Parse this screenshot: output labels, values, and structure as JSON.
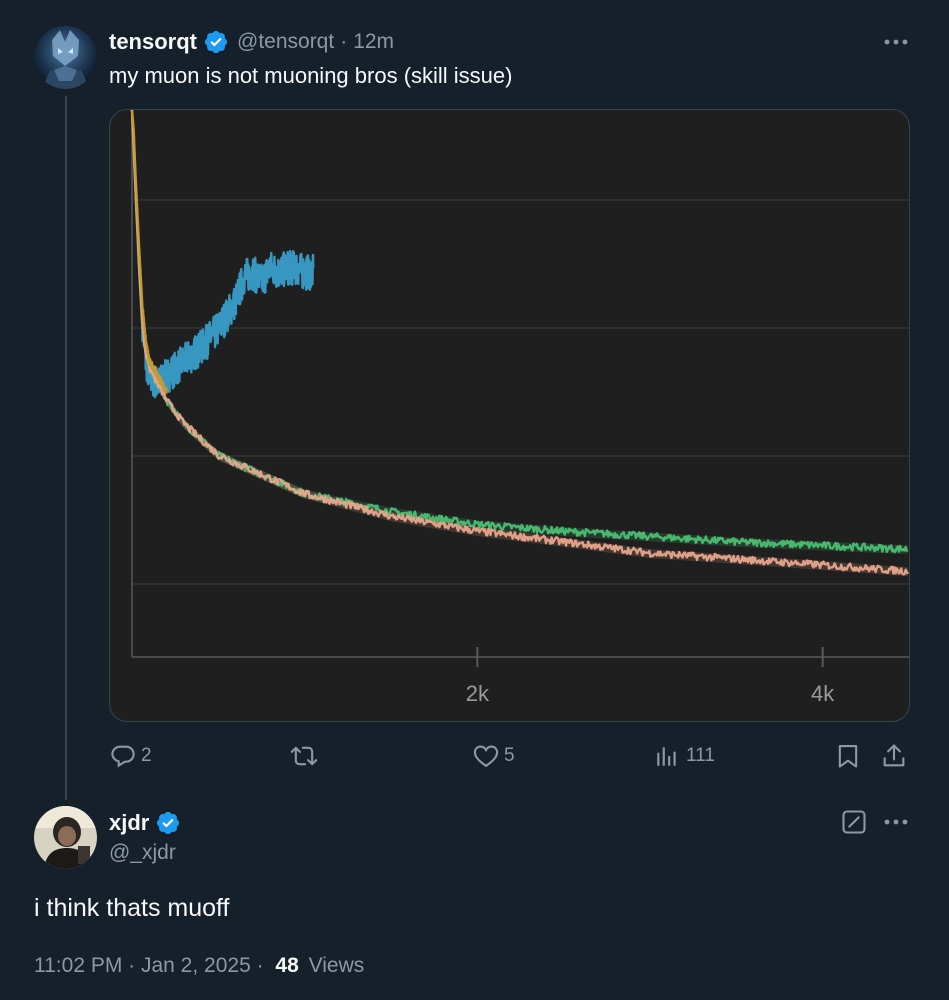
{
  "tweet": {
    "author_name": "tensorqt",
    "handle": "@tensorqt",
    "separator": "·",
    "time_ago": "12m",
    "text": "my muon is not muoning bros (skill issue)",
    "more_icon": "more-dots-icon",
    "actions": {
      "replies": "2",
      "retweets": "",
      "likes": "5",
      "views": "111"
    },
    "chart_data": {
      "type": "line",
      "x_tick_labels": [
        "2k",
        "4k"
      ],
      "xlim": [
        0,
        4500
      ],
      "grid": true,
      "series": [
        {
          "color": "#3a9ec9",
          "x": [
            0,
            20,
            40,
            60,
            80,
            100,
            150,
            200,
            300,
            400,
            500,
            600,
            650,
            700,
            750,
            800,
            850,
            900,
            950,
            1000,
            1050
          ],
          "y": [
            100,
            68,
            46,
            33,
            27,
            25,
            24,
            25,
            27,
            29,
            32,
            37,
            42,
            43,
            41,
            44,
            43,
            44,
            44,
            43,
            43
          ]
        },
        {
          "color": "#4bbf73",
          "x": [
            0,
            20,
            40,
            60,
            80,
            100,
            200,
            300,
            500,
            1000,
            1500,
            2000,
            2500,
            3000,
            3500,
            4000,
            4500
          ],
          "y": [
            100,
            66,
            44,
            32,
            28,
            26,
            22,
            19.5,
            16.5,
            13.5,
            12.3,
            11.5,
            11.1,
            10.8,
            10.5,
            10.3,
            10.1
          ]
        },
        {
          "color": "#e8a58c",
          "x": [
            0,
            20,
            40,
            60,
            80,
            100,
            200,
            300,
            500,
            1000,
            1500,
            2000,
            2500,
            3000,
            3500,
            4000,
            4500
          ],
          "y": [
            100,
            67,
            45,
            33,
            28,
            26,
            22,
            19.5,
            16.5,
            13.5,
            12,
            11.1,
            10.5,
            9.9,
            9.6,
            9.3,
            9
          ]
        },
        {
          "color": "#c99a2e",
          "x": [
            0,
            10,
            20,
            40,
            60,
            80,
            100,
            150,
            200
          ],
          "y": [
            100,
            90,
            72,
            50,
            36,
            30,
            27,
            25,
            23
          ]
        }
      ]
    }
  },
  "reply": {
    "author_name": "xjdr",
    "handle": "@_xjdr",
    "text": "i think thats muoff",
    "timestamp": "11:02 PM · Jan 2, 2025 ·",
    "views_count": "48",
    "views_label": "Views"
  }
}
